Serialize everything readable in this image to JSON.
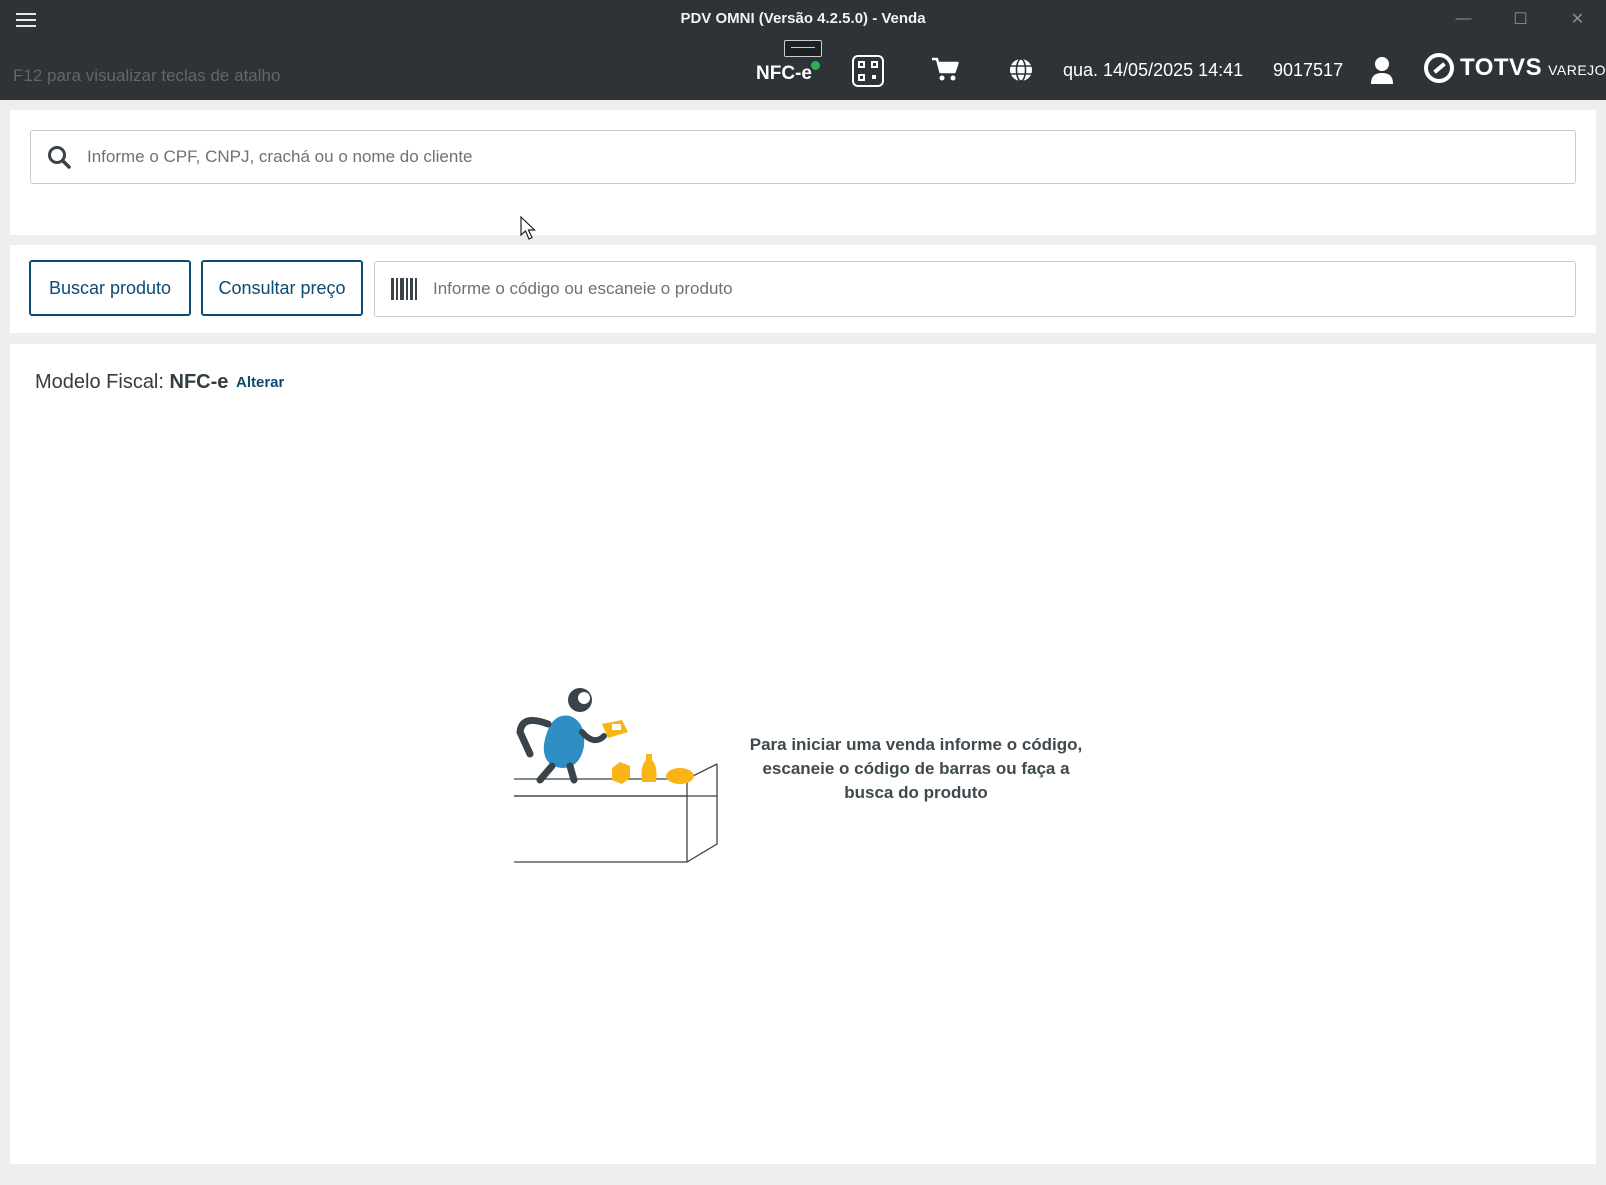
{
  "window": {
    "title": "PDV OMNI (Versão 4.2.5.0) - Venda",
    "controls": [
      "—",
      "☐",
      "✕"
    ]
  },
  "header": {
    "hint": "F12 para visualizar teclas de atalho",
    "fiscal_device": "NFC-e",
    "fiscal_status_color": "#2bb24c",
    "datetime": "qua. 14/05/2025 14:41",
    "store_code": "9017517",
    "logo": {
      "name": "TOTVS",
      "sub": "VAREJO"
    },
    "icons": [
      "menu-icon",
      "printer-icon",
      "qr-code-icon",
      "cart-icon",
      "globe-icon",
      "user-icon"
    ]
  },
  "customer_search": {
    "placeholder": "Informe o CPF, CNPJ, crachá ou o nome do cliente",
    "icon": "search-icon"
  },
  "product_bar": {
    "search_button": "Buscar produto",
    "price_button": "Consultar preço",
    "code_placeholder": "Informe o código ou escaneie o produto",
    "icon": "barcode-icon"
  },
  "sale": {
    "fiscal_label": "Modelo Fiscal:",
    "fiscal_value": "NFC-e",
    "change_link": "Alterar",
    "empty_message": "Para iniciar uma venda informe o código, escaneie o código de barras ou faça a busca do produto"
  },
  "colors": {
    "header_bg": "#2d3336",
    "accent": "#0c4a72",
    "product_yellow": "#f8b515",
    "figure_blue": "#2d8fc4"
  }
}
